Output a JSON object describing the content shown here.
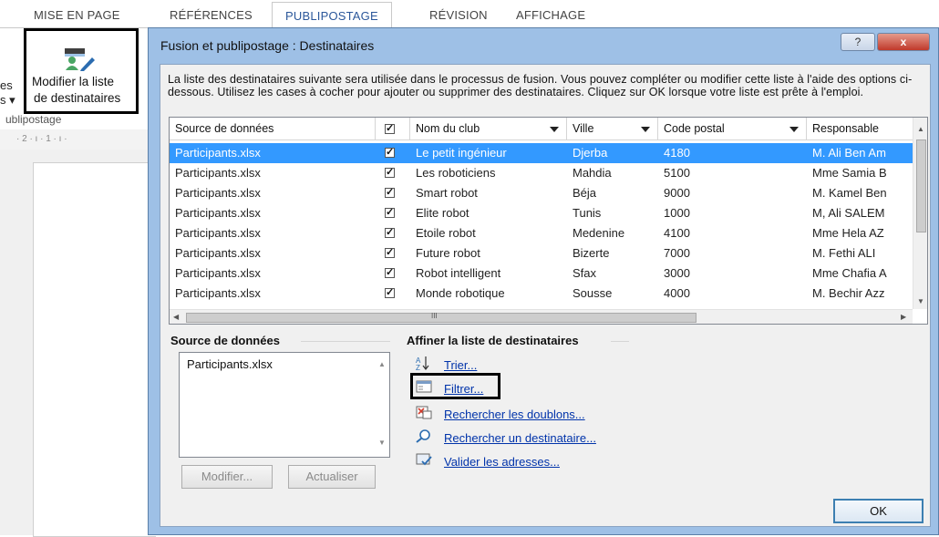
{
  "ribbon": {
    "tabs": [
      "MISE EN PAGE",
      "RÉFÉRENCES",
      "PUBLIPOSTAGE",
      "RÉVISION",
      "AFFICHAGE"
    ],
    "active_tab": "PUBLIPOSTAGE",
    "left_fragment_1": "es",
    "left_fragment_2": "s ▾",
    "button_line1": "Modifier la liste",
    "button_line2": "de destinataires",
    "group_label": "ublipostage",
    "ruler_text": "· 2 · ı · 1 · ı ·"
  },
  "dialog": {
    "title": "Fusion et publipostage : Destinataires",
    "help_symbol": "?",
    "close_symbol": "x",
    "intro": "La liste des destinataires suivante sera utilisée dans le processus de fusion. Vous pouvez compléter ou modifier cette liste à l'aide des options ci-dessous. Utilisez les cases à cocher pour ajouter ou supprimer des destinataires. Cliquez sur OK lorsque votre liste est prête à l'emploi.",
    "columns": [
      "Source de données",
      "",
      "Nom du club",
      "Ville",
      "Code postal",
      "Responsable"
    ],
    "rows": [
      {
        "source": "Participants.xlsx",
        "checked": "✓",
        "club": "Le petit ingénieur",
        "ville": "Djerba",
        "cp": "4180",
        "resp": "M. Ali Ben Am"
      },
      {
        "source": "Participants.xlsx",
        "checked": "✓",
        "club": "Les roboticiens",
        "ville": "Mahdia",
        "cp": "5100",
        "resp": "Mme Samia B"
      },
      {
        "source": "Participants.xlsx",
        "checked": "✓",
        "club": "Smart robot",
        "ville": "Béja",
        "cp": "9000",
        "resp": "M. Kamel Ben"
      },
      {
        "source": "Participants.xlsx",
        "checked": "✓",
        "club": "Elite robot",
        "ville": "Tunis",
        "cp": "1000",
        "resp": "M, Ali SALEM"
      },
      {
        "source": "Participants.xlsx",
        "checked": "✓",
        "club": "Etoile robot",
        "ville": "Medenine",
        "cp": "4100",
        "resp": "Mme Hela AZ"
      },
      {
        "source": "Participants.xlsx",
        "checked": "✓",
        "club": "Future robot",
        "ville": "Bizerte",
        "cp": "7000",
        "resp": "M. Fethi ALI"
      },
      {
        "source": "Participants.xlsx",
        "checked": "✓",
        "club": "Robot intelligent",
        "ville": "Sfax",
        "cp": "3000",
        "resp": "Mme Chafia A"
      },
      {
        "source": "Participants.xlsx",
        "checked": "✓",
        "club": "Monde robotique",
        "ville": "Sousse",
        "cp": "4000",
        "resp": "M. Bechir Azz"
      }
    ],
    "hscroll_grip": "III",
    "data_source_label": "Source de données",
    "data_source_items": [
      "Participants.xlsx"
    ],
    "modify_button": "Modifier...",
    "refresh_button": "Actualiser",
    "refine_label": "Affiner la liste de destinataires",
    "links": [
      "Trier...",
      "Filtrer...",
      "Rechercher les doublons...",
      "Rechercher un destinataire...",
      "Valider les adresses..."
    ],
    "ok_button": "OK"
  },
  "colors": {
    "selection": "#3399ff",
    "active_tab_text": "#2b579a",
    "link": "#0033aa",
    "dialog_frame": "#9ec0e6"
  }
}
